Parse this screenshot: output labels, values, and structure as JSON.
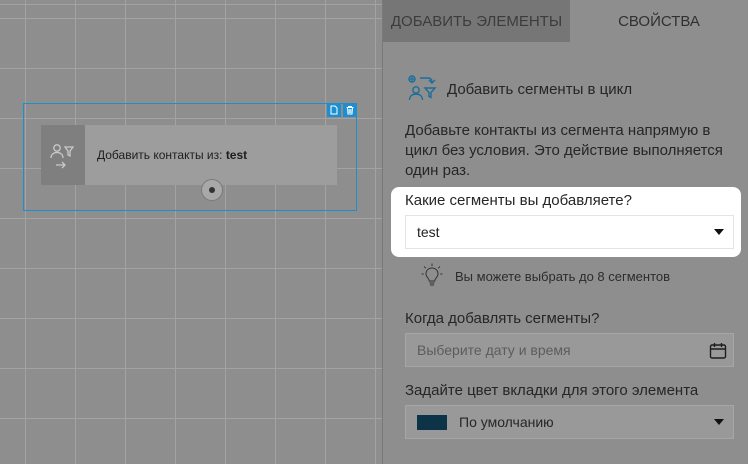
{
  "node": {
    "text": "Добавить контакты из:",
    "value": "test"
  },
  "tabs": [
    {
      "label": "ДОБАВИТЬ ЭЛЕМЕНТЫ",
      "active": true
    },
    {
      "label": "СВОЙСТВА",
      "active": false
    }
  ],
  "panel": {
    "section_title": "Добавить сегменты в цикл",
    "description": "Добавьте контакты из сегмента напрямую в цикл без условия. Это действие выполняется один раз.",
    "segments_label": "Какие сегменты вы добавляете?",
    "segments_value": "test",
    "hint": "Вы можете выбрать до 8 сегментов",
    "date_label": "Когда добавлять сегменты?",
    "date_placeholder": "Выберите дату и время",
    "color_label": "Задайте цвет вкладки для этого элемента",
    "color_value": "По умолчанию",
    "color_swatch": "#0d3346"
  },
  "colors": {
    "accent": "#1b8fd1",
    "overlay": "#8e8e8e"
  },
  "icons": [
    "copy-icon",
    "trash-icon",
    "segment-cycle-icon",
    "lightbulb-icon",
    "calendar-icon",
    "chevron-down-icon"
  ]
}
